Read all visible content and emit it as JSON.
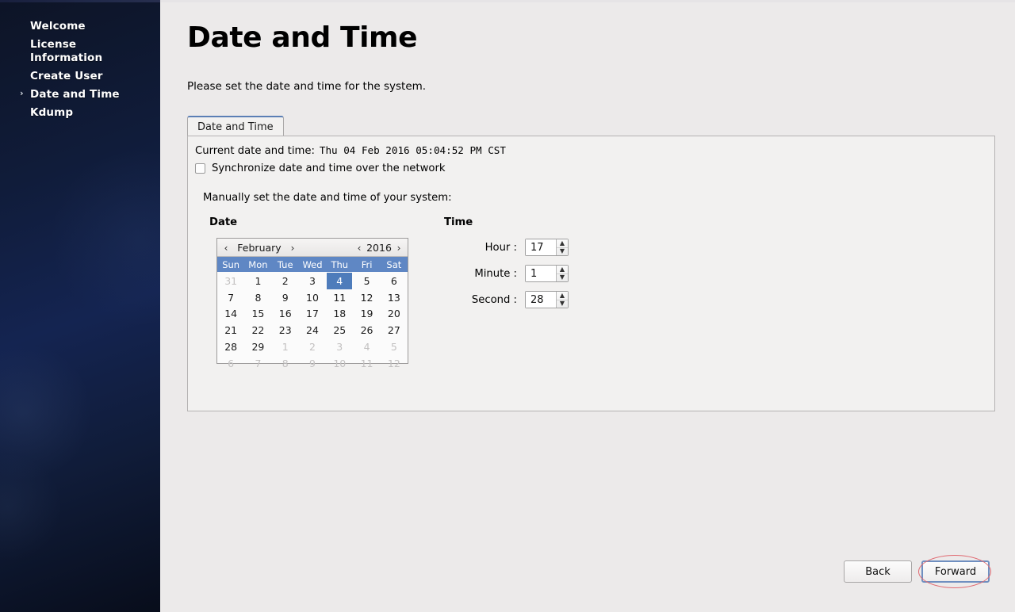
{
  "sidebar": {
    "items": [
      {
        "label": "Welcome",
        "active": false
      },
      {
        "label": "License\nInformation",
        "active": false
      },
      {
        "label": "Create User",
        "active": false
      },
      {
        "label": "Date and Time",
        "active": true
      },
      {
        "label": "Kdump",
        "active": false
      }
    ],
    "active_marker": "›"
  },
  "page": {
    "title": "Date and Time",
    "subtitle": "Please set the date and time for the system."
  },
  "tabs": [
    {
      "label": "Date and Time",
      "selected": true
    }
  ],
  "panel": {
    "current_label": "Current date and time:",
    "current_value": "Thu 04 Feb 2016 05:04:52 PM CST",
    "sync_checkbox_label": "Synchronize date and time over the network",
    "sync_checked": false,
    "manual_label": "Manually set the date and time of your system:",
    "date_heading": "Date",
    "time_heading": "Time"
  },
  "calendar": {
    "prev_month_icon": "‹",
    "next_month_icon": "›",
    "prev_year_icon": "‹",
    "next_year_icon": "›",
    "month": "February",
    "year": "2016",
    "daynames": [
      "Sun",
      "Mon",
      "Tue",
      "Wed",
      "Thu",
      "Fri",
      "Sat"
    ],
    "selected_day": 4,
    "weeks": [
      [
        {
          "d": "31",
          "other": true
        },
        {
          "d": "1"
        },
        {
          "d": "2"
        },
        {
          "d": "3"
        },
        {
          "d": "4",
          "selected": true
        },
        {
          "d": "5"
        },
        {
          "d": "6"
        }
      ],
      [
        {
          "d": "7"
        },
        {
          "d": "8"
        },
        {
          "d": "9"
        },
        {
          "d": "10"
        },
        {
          "d": "11"
        },
        {
          "d": "12"
        },
        {
          "d": "13"
        }
      ],
      [
        {
          "d": "14"
        },
        {
          "d": "15"
        },
        {
          "d": "16"
        },
        {
          "d": "17"
        },
        {
          "d": "18"
        },
        {
          "d": "19"
        },
        {
          "d": "20"
        }
      ],
      [
        {
          "d": "21"
        },
        {
          "d": "22"
        },
        {
          "d": "23"
        },
        {
          "d": "24"
        },
        {
          "d": "25"
        },
        {
          "d": "26"
        },
        {
          "d": "27"
        }
      ],
      [
        {
          "d": "28"
        },
        {
          "d": "29"
        },
        {
          "d": "1",
          "other": true
        },
        {
          "d": "2",
          "other": true
        },
        {
          "d": "3",
          "other": true
        },
        {
          "d": "4",
          "other": true
        },
        {
          "d": "5",
          "other": true
        }
      ],
      [
        {
          "d": "6",
          "other": true
        },
        {
          "d": "7",
          "other": true
        },
        {
          "d": "8",
          "other": true
        },
        {
          "d": "9",
          "other": true
        },
        {
          "d": "10",
          "other": true
        },
        {
          "d": "11",
          "other": true
        },
        {
          "d": "12",
          "other": true
        }
      ]
    ]
  },
  "time": {
    "fields": [
      {
        "label": "Hour :",
        "value": "17",
        "name": "hour"
      },
      {
        "label": "Minute :",
        "value": "1",
        "name": "minute"
      },
      {
        "label": "Second :",
        "value": "28",
        "name": "second"
      }
    ],
    "up_icon": "▲",
    "down_icon": "▼"
  },
  "footer": {
    "back_label": "Back",
    "forward_label": "Forward"
  },
  "annotation": {
    "shape": "ellipse",
    "color": "#e06a72",
    "target": "Forward"
  },
  "colors": {
    "sidebar_dark": "#0d1426",
    "sidebar_mid": "#142451",
    "page_bg": "#eceaea",
    "panel_bg": "#f2f1f0",
    "calendar_header_blue": "#5f87c4",
    "calendar_selected_blue": "#4e7cbb",
    "tab_accent": "#5b7fb5",
    "annotation_red": "#e06a72"
  }
}
